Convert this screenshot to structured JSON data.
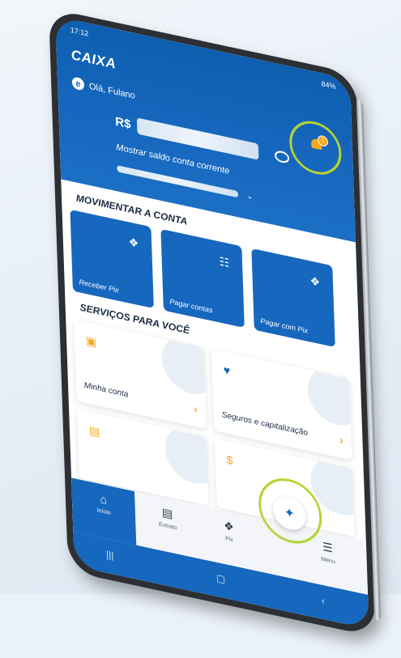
{
  "status": {
    "time": "17:12",
    "battery": "84%"
  },
  "app": {
    "logo": "CAIXA"
  },
  "header": {
    "greeting": "Olá, Fulano",
    "currency": "R$",
    "show_balance": "Mostrar saldo conta corrente",
    "notification_count": "3"
  },
  "sections": {
    "move": "MOVIMENTAR A CONTA",
    "services": "SERVIÇOS PARA VOCÊ"
  },
  "actions": [
    {
      "label": "Receber Pix",
      "icon": "pix-icon"
    },
    {
      "label": "Pagar contas",
      "icon": "barcode-icon"
    },
    {
      "label": "Pagar com Pix",
      "icon": "pix-icon"
    }
  ],
  "services": [
    {
      "label": "Minha conta",
      "icon": "wallet-icon"
    },
    {
      "label": "Seguros e capitalização",
      "icon": "heart-icon"
    },
    {
      "label": "",
      "icon": "card-icon"
    },
    {
      "label": "",
      "icon": "money-hand-icon"
    }
  ],
  "nav": [
    {
      "label": "Início",
      "icon": "home-icon"
    },
    {
      "label": "Extrato",
      "icon": "statement-icon"
    },
    {
      "label": "Pix",
      "icon": "pix-icon"
    },
    {
      "label": "Menu",
      "icon": "menu-icon"
    }
  ],
  "colors": {
    "primary": "#1667be",
    "accent": "#f7a81b",
    "highlight_ring": "#b5d334"
  }
}
